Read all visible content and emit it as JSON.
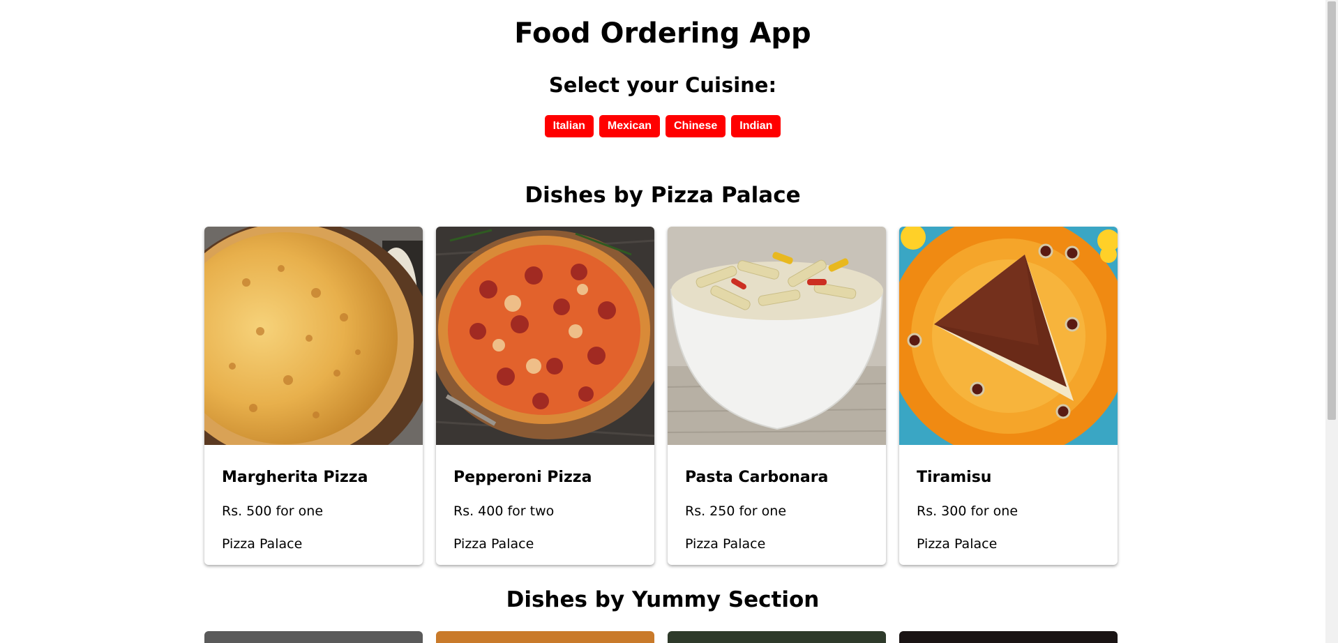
{
  "app_title": "Food Ordering App",
  "cuisine_heading": "Select your Cuisine:",
  "cuisines": [
    "Italian",
    "Mexican",
    "Chinese",
    "Indian"
  ],
  "sections": [
    {
      "title": "Dishes by Pizza Palace",
      "dishes": [
        {
          "name": "Margherita Pizza",
          "price": "Rs. 500 for one",
          "restaurant": "Pizza Palace",
          "icon": "margherita-pizza-image"
        },
        {
          "name": "Pepperoni Pizza",
          "price": "Rs. 400 for two",
          "restaurant": "Pizza Palace",
          "icon": "pepperoni-pizza-image"
        },
        {
          "name": "Pasta Carbonara",
          "price": "Rs. 250 for one",
          "restaurant": "Pizza Palace",
          "icon": "pasta-carbonara-image"
        },
        {
          "name": "Tiramisu",
          "price": "Rs. 300 for one",
          "restaurant": "Pizza Palace",
          "icon": "tiramisu-image"
        }
      ]
    },
    {
      "title": "Dishes by Yummy Section"
    }
  ],
  "colors": {
    "button_bg": "#ff0000",
    "button_text": "#ffffff"
  }
}
